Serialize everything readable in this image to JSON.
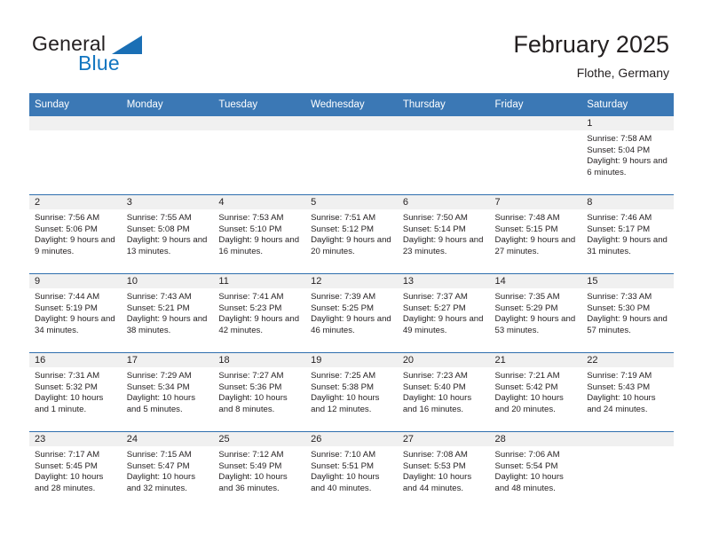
{
  "brand": {
    "name_top": "General",
    "name_bottom": "Blue",
    "triangle_icon": "blue-triangle-icon",
    "color_dark": "#231f20",
    "color_blue": "#1175c0"
  },
  "header": {
    "title": "February 2025",
    "subtitle": "Flothe, Germany"
  },
  "theme": {
    "header_blue": "#3b78b5",
    "row_divider_blue": "#2f6fae",
    "day_band_gray": "#f0f0f0",
    "text": "#231f20"
  },
  "weekdays": [
    "Sunday",
    "Monday",
    "Tuesday",
    "Wednesday",
    "Thursday",
    "Friday",
    "Saturday"
  ],
  "labels": {
    "sunrise_prefix": "Sunrise:",
    "sunset_prefix": "Sunset:",
    "daylight_prefix": "Daylight:"
  },
  "weeks": [
    [
      {
        "day": "",
        "sunrise": "",
        "sunset": "",
        "daylight": "",
        "empty": true
      },
      {
        "day": "",
        "sunrise": "",
        "sunset": "",
        "daylight": "",
        "empty": true
      },
      {
        "day": "",
        "sunrise": "",
        "sunset": "",
        "daylight": "",
        "empty": true
      },
      {
        "day": "",
        "sunrise": "",
        "sunset": "",
        "daylight": "",
        "empty": true
      },
      {
        "day": "",
        "sunrise": "",
        "sunset": "",
        "daylight": "",
        "empty": true
      },
      {
        "day": "",
        "sunrise": "",
        "sunset": "",
        "daylight": "",
        "empty": true
      },
      {
        "day": "1",
        "sunrise": "Sunrise: 7:58 AM",
        "sunset": "Sunset: 5:04 PM",
        "daylight": "Daylight: 9 hours and 6 minutes."
      }
    ],
    [
      {
        "day": "2",
        "sunrise": "Sunrise: 7:56 AM",
        "sunset": "Sunset: 5:06 PM",
        "daylight": "Daylight: 9 hours and 9 minutes."
      },
      {
        "day": "3",
        "sunrise": "Sunrise: 7:55 AM",
        "sunset": "Sunset: 5:08 PM",
        "daylight": "Daylight: 9 hours and 13 minutes."
      },
      {
        "day": "4",
        "sunrise": "Sunrise: 7:53 AM",
        "sunset": "Sunset: 5:10 PM",
        "daylight": "Daylight: 9 hours and 16 minutes."
      },
      {
        "day": "5",
        "sunrise": "Sunrise: 7:51 AM",
        "sunset": "Sunset: 5:12 PM",
        "daylight": "Daylight: 9 hours and 20 minutes."
      },
      {
        "day": "6",
        "sunrise": "Sunrise: 7:50 AM",
        "sunset": "Sunset: 5:14 PM",
        "daylight": "Daylight: 9 hours and 23 minutes."
      },
      {
        "day": "7",
        "sunrise": "Sunrise: 7:48 AM",
        "sunset": "Sunset: 5:15 PM",
        "daylight": "Daylight: 9 hours and 27 minutes."
      },
      {
        "day": "8",
        "sunrise": "Sunrise: 7:46 AM",
        "sunset": "Sunset: 5:17 PM",
        "daylight": "Daylight: 9 hours and 31 minutes."
      }
    ],
    [
      {
        "day": "9",
        "sunrise": "Sunrise: 7:44 AM",
        "sunset": "Sunset: 5:19 PM",
        "daylight": "Daylight: 9 hours and 34 minutes."
      },
      {
        "day": "10",
        "sunrise": "Sunrise: 7:43 AM",
        "sunset": "Sunset: 5:21 PM",
        "daylight": "Daylight: 9 hours and 38 minutes."
      },
      {
        "day": "11",
        "sunrise": "Sunrise: 7:41 AM",
        "sunset": "Sunset: 5:23 PM",
        "daylight": "Daylight: 9 hours and 42 minutes."
      },
      {
        "day": "12",
        "sunrise": "Sunrise: 7:39 AM",
        "sunset": "Sunset: 5:25 PM",
        "daylight": "Daylight: 9 hours and 46 minutes."
      },
      {
        "day": "13",
        "sunrise": "Sunrise: 7:37 AM",
        "sunset": "Sunset: 5:27 PM",
        "daylight": "Daylight: 9 hours and 49 minutes."
      },
      {
        "day": "14",
        "sunrise": "Sunrise: 7:35 AM",
        "sunset": "Sunset: 5:29 PM",
        "daylight": "Daylight: 9 hours and 53 minutes."
      },
      {
        "day": "15",
        "sunrise": "Sunrise: 7:33 AM",
        "sunset": "Sunset: 5:30 PM",
        "daylight": "Daylight: 9 hours and 57 minutes."
      }
    ],
    [
      {
        "day": "16",
        "sunrise": "Sunrise: 7:31 AM",
        "sunset": "Sunset: 5:32 PM",
        "daylight": "Daylight: 10 hours and 1 minute."
      },
      {
        "day": "17",
        "sunrise": "Sunrise: 7:29 AM",
        "sunset": "Sunset: 5:34 PM",
        "daylight": "Daylight: 10 hours and 5 minutes."
      },
      {
        "day": "18",
        "sunrise": "Sunrise: 7:27 AM",
        "sunset": "Sunset: 5:36 PM",
        "daylight": "Daylight: 10 hours and 8 minutes."
      },
      {
        "day": "19",
        "sunrise": "Sunrise: 7:25 AM",
        "sunset": "Sunset: 5:38 PM",
        "daylight": "Daylight: 10 hours and 12 minutes."
      },
      {
        "day": "20",
        "sunrise": "Sunrise: 7:23 AM",
        "sunset": "Sunset: 5:40 PM",
        "daylight": "Daylight: 10 hours and 16 minutes."
      },
      {
        "day": "21",
        "sunrise": "Sunrise: 7:21 AM",
        "sunset": "Sunset: 5:42 PM",
        "daylight": "Daylight: 10 hours and 20 minutes."
      },
      {
        "day": "22",
        "sunrise": "Sunrise: 7:19 AM",
        "sunset": "Sunset: 5:43 PM",
        "daylight": "Daylight: 10 hours and 24 minutes."
      }
    ],
    [
      {
        "day": "23",
        "sunrise": "Sunrise: 7:17 AM",
        "sunset": "Sunset: 5:45 PM",
        "daylight": "Daylight: 10 hours and 28 minutes."
      },
      {
        "day": "24",
        "sunrise": "Sunrise: 7:15 AM",
        "sunset": "Sunset: 5:47 PM",
        "daylight": "Daylight: 10 hours and 32 minutes."
      },
      {
        "day": "25",
        "sunrise": "Sunrise: 7:12 AM",
        "sunset": "Sunset: 5:49 PM",
        "daylight": "Daylight: 10 hours and 36 minutes."
      },
      {
        "day": "26",
        "sunrise": "Sunrise: 7:10 AM",
        "sunset": "Sunset: 5:51 PM",
        "daylight": "Daylight: 10 hours and 40 minutes."
      },
      {
        "day": "27",
        "sunrise": "Sunrise: 7:08 AM",
        "sunset": "Sunset: 5:53 PM",
        "daylight": "Daylight: 10 hours and 44 minutes."
      },
      {
        "day": "28",
        "sunrise": "Sunrise: 7:06 AM",
        "sunset": "Sunset: 5:54 PM",
        "daylight": "Daylight: 10 hours and 48 minutes."
      },
      {
        "day": "",
        "sunrise": "",
        "sunset": "",
        "daylight": "",
        "empty": true
      }
    ]
  ]
}
